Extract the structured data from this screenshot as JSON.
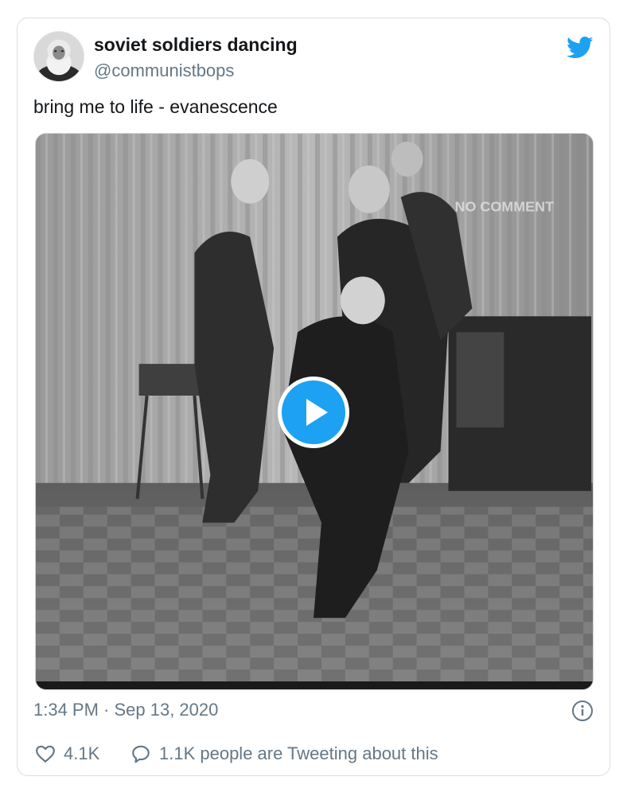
{
  "tweet": {
    "author_name": "soviet soldiers dancing",
    "author_handle": "@communistbops",
    "text": "bring me to life - evanescence",
    "timestamp": "1:34 PM · Sep 13, 2020",
    "likes": "4.1K",
    "tweeting_about": "1.1K people are Tweeting about this",
    "video_watermark": "NO COMMENT"
  },
  "icons": {
    "brand": "twitter-bird-icon",
    "play": "play-icon",
    "info": "info-icon",
    "like": "heart-icon",
    "reply": "speech-bubble-icon"
  },
  "colors": {
    "brand_blue": "#1da1f2",
    "secondary_text": "#657786",
    "primary_text": "#14171a",
    "border": "#d8dde2"
  }
}
